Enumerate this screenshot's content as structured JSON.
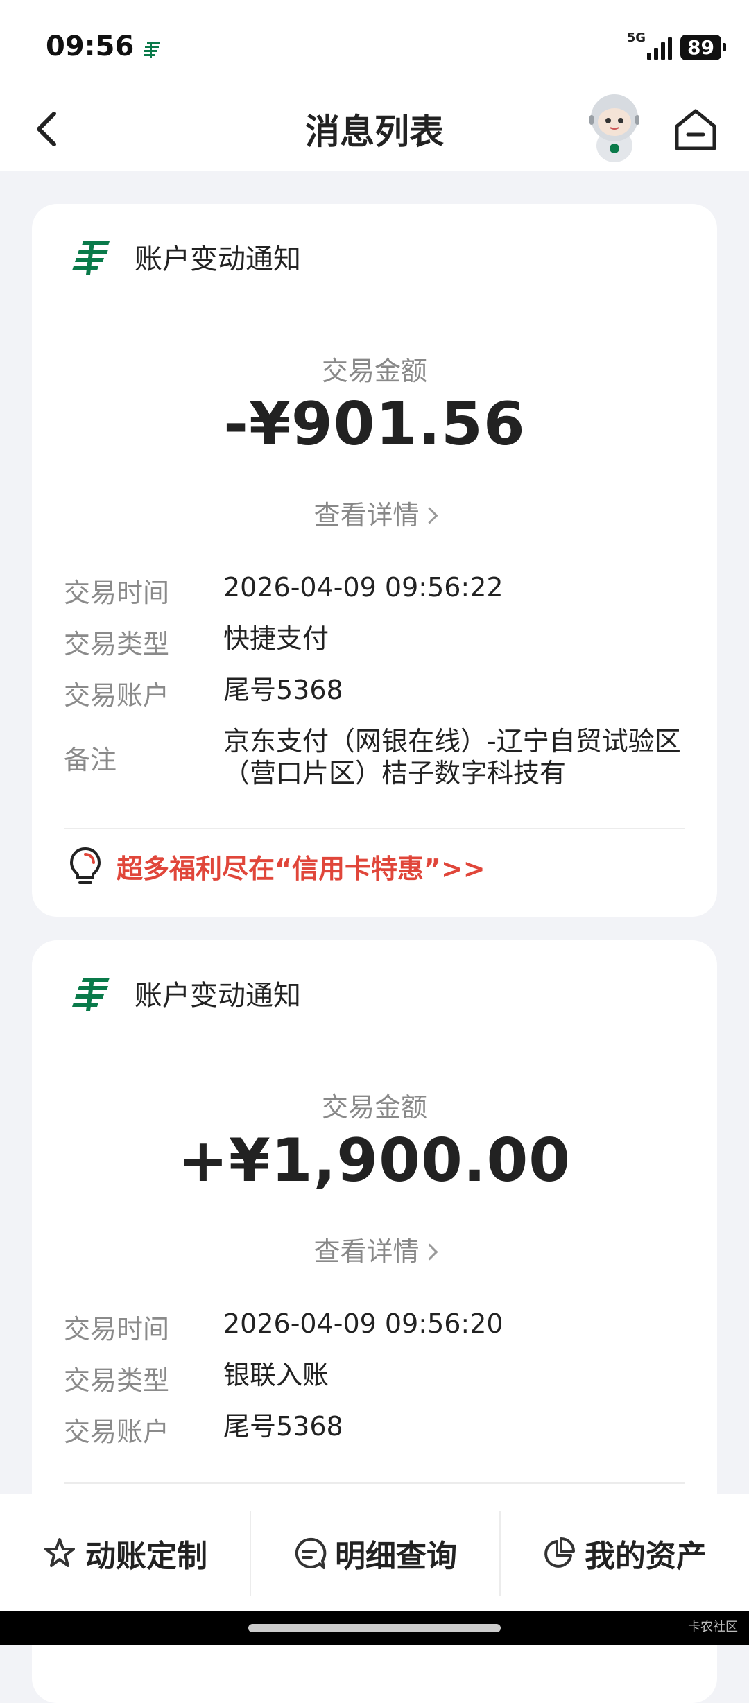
{
  "status_bar": {
    "time": "09:56",
    "network": "5G",
    "battery": "89"
  },
  "nav": {
    "title": "消息列表"
  },
  "messages": [
    {
      "header": "账户变动通知",
      "amount_label": "交易金额",
      "amount": "-¥901.56",
      "detail_link": "查看详情",
      "rows": [
        {
          "key": "交易时间",
          "value": "2026-04-09 09:56:22"
        },
        {
          "key": "交易类型",
          "value": "快捷支付"
        },
        {
          "key": "交易账户",
          "value": "尾号5368"
        },
        {
          "key": "备注",
          "value": "京东支付（网银在线）-辽宁自贸试验区（营口片区）桔子数字科技有"
        }
      ],
      "promo": "超多福利尽在“信用卡特惠”>>"
    },
    {
      "header": "账户变动通知",
      "amount_label": "交易金额",
      "amount": "+¥1,900.00",
      "detail_link": "查看详情",
      "rows": [
        {
          "key": "交易时间",
          "value": "2026-04-09 09:56:20"
        },
        {
          "key": "交易类型",
          "value": "银联入账"
        },
        {
          "key": "交易账户",
          "value": "尾号5368"
        }
      ]
    }
  ],
  "tabs": [
    {
      "label": "动账定制",
      "icon": "star-settings-icon"
    },
    {
      "label": "明细查询",
      "icon": "search-list-icon"
    },
    {
      "label": "我的资产",
      "icon": "pie-chart-icon"
    }
  ],
  "watermark": "卡农社区",
  "colors": {
    "brand_green": "#0a7a4a",
    "promo_red": "#e0463a"
  }
}
